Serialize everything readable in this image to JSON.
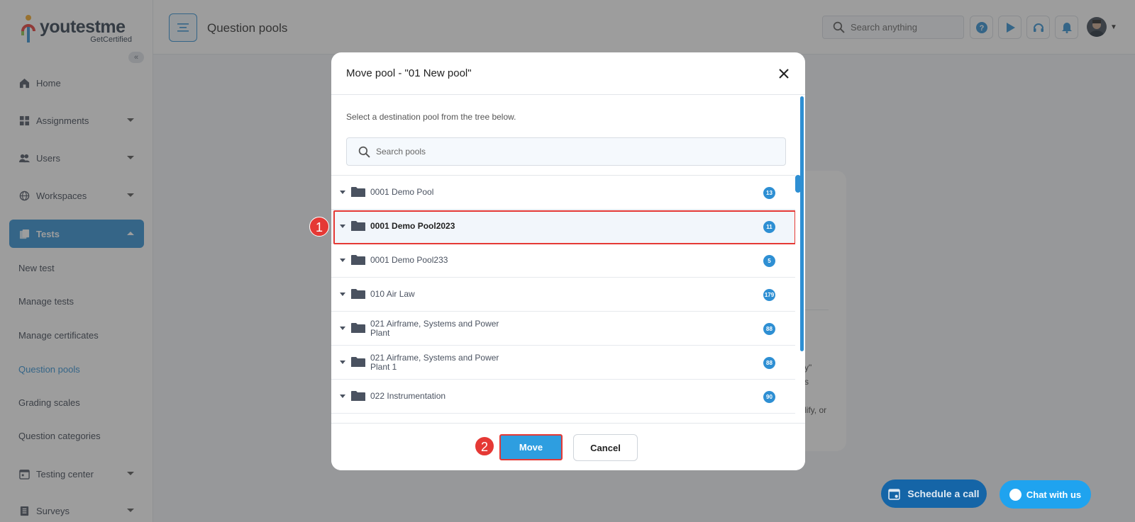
{
  "app": {
    "brand": "youtestme",
    "brand_sub": "GetCertified"
  },
  "sidebar": {
    "items": [
      {
        "label": "Home",
        "icon": "home-icon"
      },
      {
        "label": "Assignments",
        "icon": "assignments-icon"
      },
      {
        "label": "Users",
        "icon": "users-icon"
      },
      {
        "label": "Workspaces",
        "icon": "globe-icon"
      },
      {
        "label": "Tests",
        "icon": "tests-icon"
      },
      {
        "label": "Testing center",
        "icon": "calendar-icon"
      },
      {
        "label": "Surveys",
        "icon": "surveys-icon"
      }
    ],
    "sub_items": [
      "New test",
      "Manage tests",
      "Manage certificates",
      "Question pools",
      "Grading scales",
      "Question categories"
    ]
  },
  "header": {
    "title": "Question pools",
    "search_placeholder": "Search anything"
  },
  "background_card": {
    "fragments": [
      "y\"",
      "s",
      "lify, or"
    ]
  },
  "modal": {
    "title": "Move pool - \"01 New pool\"",
    "instructions": "Select a destination pool from the tree below.",
    "search_placeholder": "Search pools",
    "pools": [
      {
        "name": "0001 Demo Pool",
        "count": "13"
      },
      {
        "name": "0001 Demo Pool2023",
        "count": "11"
      },
      {
        "name": "0001 Demo Pool233",
        "count": "5"
      },
      {
        "name": "010 Air Law",
        "count": "179"
      },
      {
        "name": "021 Airframe, Systems and Power Plant",
        "count": "88"
      },
      {
        "name": "021 Airframe, Systems and Power Plant 1",
        "count": "88"
      },
      {
        "name": "022 Instrumentation",
        "count": "90"
      }
    ],
    "move_label": "Move",
    "cancel_label": "Cancel"
  },
  "annotations": {
    "step1": "1",
    "step2": "2"
  },
  "floating": {
    "schedule_label": "Schedule a call",
    "chat_label": "Chat with us"
  },
  "colors": {
    "accent": "#2e8fd3",
    "highlight": "#e53935"
  }
}
